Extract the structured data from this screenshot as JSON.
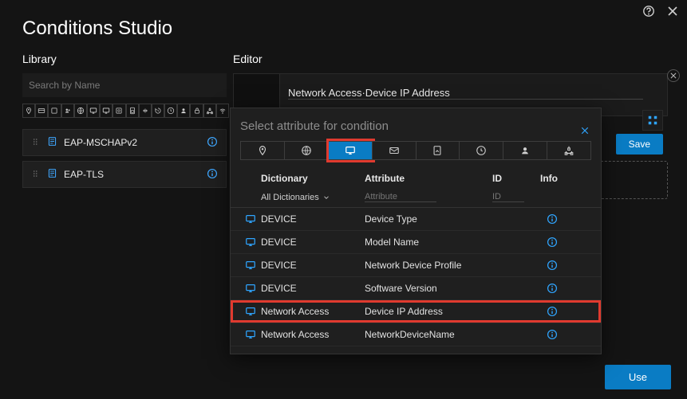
{
  "titlebar": {
    "help": "help-icon",
    "close": "close-icon"
  },
  "page_title": "Conditions Studio",
  "library": {
    "heading": "Library",
    "search_placeholder": "Search by Name",
    "iconbar": [
      "pin",
      "card",
      "square",
      "group",
      "globe",
      "monitor",
      "monitor2",
      "badge",
      "sim",
      "arrows",
      "history",
      "clock",
      "user",
      "lock",
      "sitemap",
      "wifi"
    ],
    "items": [
      {
        "name": "EAP-MSCHAPv2"
      },
      {
        "name": "EAP-TLS"
      }
    ]
  },
  "editor": {
    "heading": "Editor",
    "freetext": "Network Access·Device IP Address",
    "save_label": "Save",
    "use_label": "Use"
  },
  "popover": {
    "title": "Select attribute for condition",
    "tabs": [
      "pin",
      "globe",
      "monitor",
      "envelope",
      "page",
      "clock",
      "user",
      "sitemap"
    ],
    "active_tab_index": 2,
    "columns": {
      "dict": "Dictionary",
      "attr": "Attribute",
      "id": "ID",
      "info": "Info"
    },
    "filter": {
      "dict_label": "All Dictionaries",
      "attr_placeholder": "Attribute",
      "id_placeholder": "ID"
    },
    "rows": [
      {
        "dict": "DEVICE",
        "attr": "Device Type",
        "highlight": false
      },
      {
        "dict": "DEVICE",
        "attr": "Model Name",
        "highlight": false
      },
      {
        "dict": "DEVICE",
        "attr": "Network Device Profile",
        "highlight": false
      },
      {
        "dict": "DEVICE",
        "attr": "Software Version",
        "highlight": false
      },
      {
        "dict": "Network Access",
        "attr": "Device IP Address",
        "highlight": true
      },
      {
        "dict": "Network Access",
        "attr": "NetworkDeviceName",
        "highlight": false
      }
    ]
  }
}
